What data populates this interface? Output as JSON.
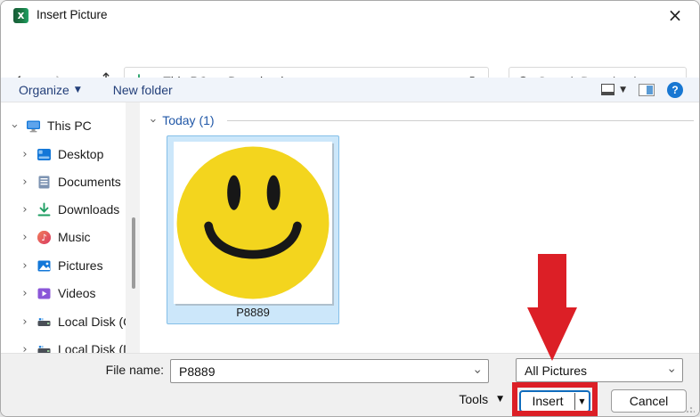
{
  "window": {
    "title": "Insert Picture"
  },
  "nav": {
    "breadcrumb": {
      "item1": "This PC",
      "item2": "Downloads"
    },
    "search_placeholder": "Search Downloads"
  },
  "toolbar": {
    "organize_label": "Organize",
    "new_folder_label": "New folder",
    "help_label": "?"
  },
  "sidebar": {
    "root_label": "This PC",
    "items": [
      {
        "label": "Desktop",
        "icon": "desktop-icon"
      },
      {
        "label": "Documents",
        "icon": "documents-icon"
      },
      {
        "label": "Downloads",
        "icon": "downloads-icon"
      },
      {
        "label": "Music",
        "icon": "music-icon"
      },
      {
        "label": "Pictures",
        "icon": "pictures-icon"
      },
      {
        "label": "Videos",
        "icon": "videos-icon"
      },
      {
        "label": "Local Disk (C:)",
        "icon": "disk-icon"
      },
      {
        "label": "Local Disk (D:)",
        "icon": "disk-icon"
      }
    ]
  },
  "content": {
    "group_label": "Today (1)",
    "file": {
      "name": "P8889",
      "thumbnail": "yellow-smiley-face",
      "selected": true
    }
  },
  "footer": {
    "file_name_label": "File name:",
    "file_name_value": "P8889",
    "file_type_value": "All Pictures",
    "tools_label": "Tools",
    "insert_label": "Insert",
    "cancel_label": "Cancel"
  },
  "glyphs": {
    "back": "←",
    "forward": "→",
    "up": "↑",
    "refresh": "↻",
    "breadcrumb_sep": "›",
    "chevron": "›",
    "dropdown": "▾",
    "split_arrow": "▼",
    "close": "×",
    "music_note": "♪",
    "excel_x": "x"
  },
  "colors": {
    "annotation_red": "#dc1f26",
    "selection_blue": "#cce7fa",
    "selection_border": "#84bfe8",
    "accent_blue": "#0f6cbd",
    "command_text_blue": "#24407a",
    "group_header_blue": "#2057a7",
    "smiley_yellow": "#f3d51e",
    "downloads_green": "#1e9e62",
    "help_blue": "#1877d2"
  }
}
